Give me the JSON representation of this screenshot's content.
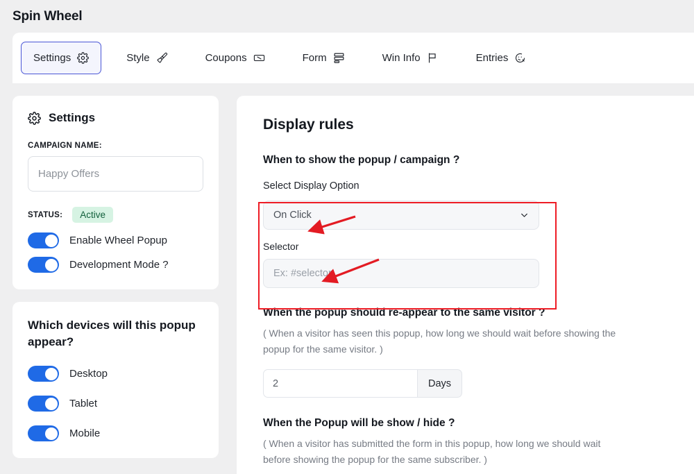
{
  "header": {
    "title": "Spin Wheel"
  },
  "tabs": [
    {
      "label": "Settings",
      "icon": "gear-icon",
      "active": true
    },
    {
      "label": "Style",
      "icon": "paintbrush-icon",
      "active": false
    },
    {
      "label": "Coupons",
      "icon": "ticket-percent-icon",
      "active": false
    },
    {
      "label": "Form",
      "icon": "form-layout-icon",
      "active": false
    },
    {
      "label": "Win Info",
      "icon": "flag-icon",
      "active": false
    },
    {
      "label": "Entries",
      "icon": "face-x-icon",
      "active": false
    }
  ],
  "settings_card": {
    "title": "Settings",
    "icon": "gear-icon",
    "campaign_name_label": "CAMPAIGN NAME:",
    "campaign_name_value": "",
    "campaign_name_placeholder": "Happy Offers",
    "status_label": "STATUS:",
    "status_value": "Active",
    "toggles": [
      {
        "label": "Enable Wheel Popup",
        "on": true
      },
      {
        "label": "Development Mode ?",
        "on": true
      }
    ]
  },
  "devices_card": {
    "title": "Which devices will this popup appear?",
    "toggles": [
      {
        "label": "Desktop",
        "on": true
      },
      {
        "label": "Tablet",
        "on": true
      },
      {
        "label": "Mobile",
        "on": true
      }
    ]
  },
  "display_rules": {
    "heading": "Display rules",
    "when_show_heading": "When to show the popup / campaign ?",
    "select_display_option_label": "Select Display Option",
    "display_option_value": "On Click",
    "selector_label": "Selector",
    "selector_value": "",
    "selector_placeholder": "Ex: #selector",
    "reappear_heading": "When the popup should re-appear to the same visitor ?",
    "reappear_hint": "( When a visitor has seen this popup, how long we should wait before showing the popup for the same visitor. )",
    "reappear_value": "2",
    "reappear_unit": "Days",
    "showhide_heading": "When the Popup will be show / hide ?",
    "showhide_hint": "( When a visitor has submitted the form in this popup, how long we should wait before showing the popup for the same subscriber. )"
  },
  "annotations": {
    "highlight_color": "#ee1c25",
    "arrow_color": "#e31b23",
    "arrow_targets": [
      "display-option-dropdown",
      "selector-input"
    ]
  },
  "colors": {
    "accent_blue": "#4a56d6",
    "toggle_on": "#1f6ae6",
    "status_badge_bg": "#d6f3e3",
    "status_badge_text": "#12603c",
    "page_bg": "#efeff0"
  }
}
